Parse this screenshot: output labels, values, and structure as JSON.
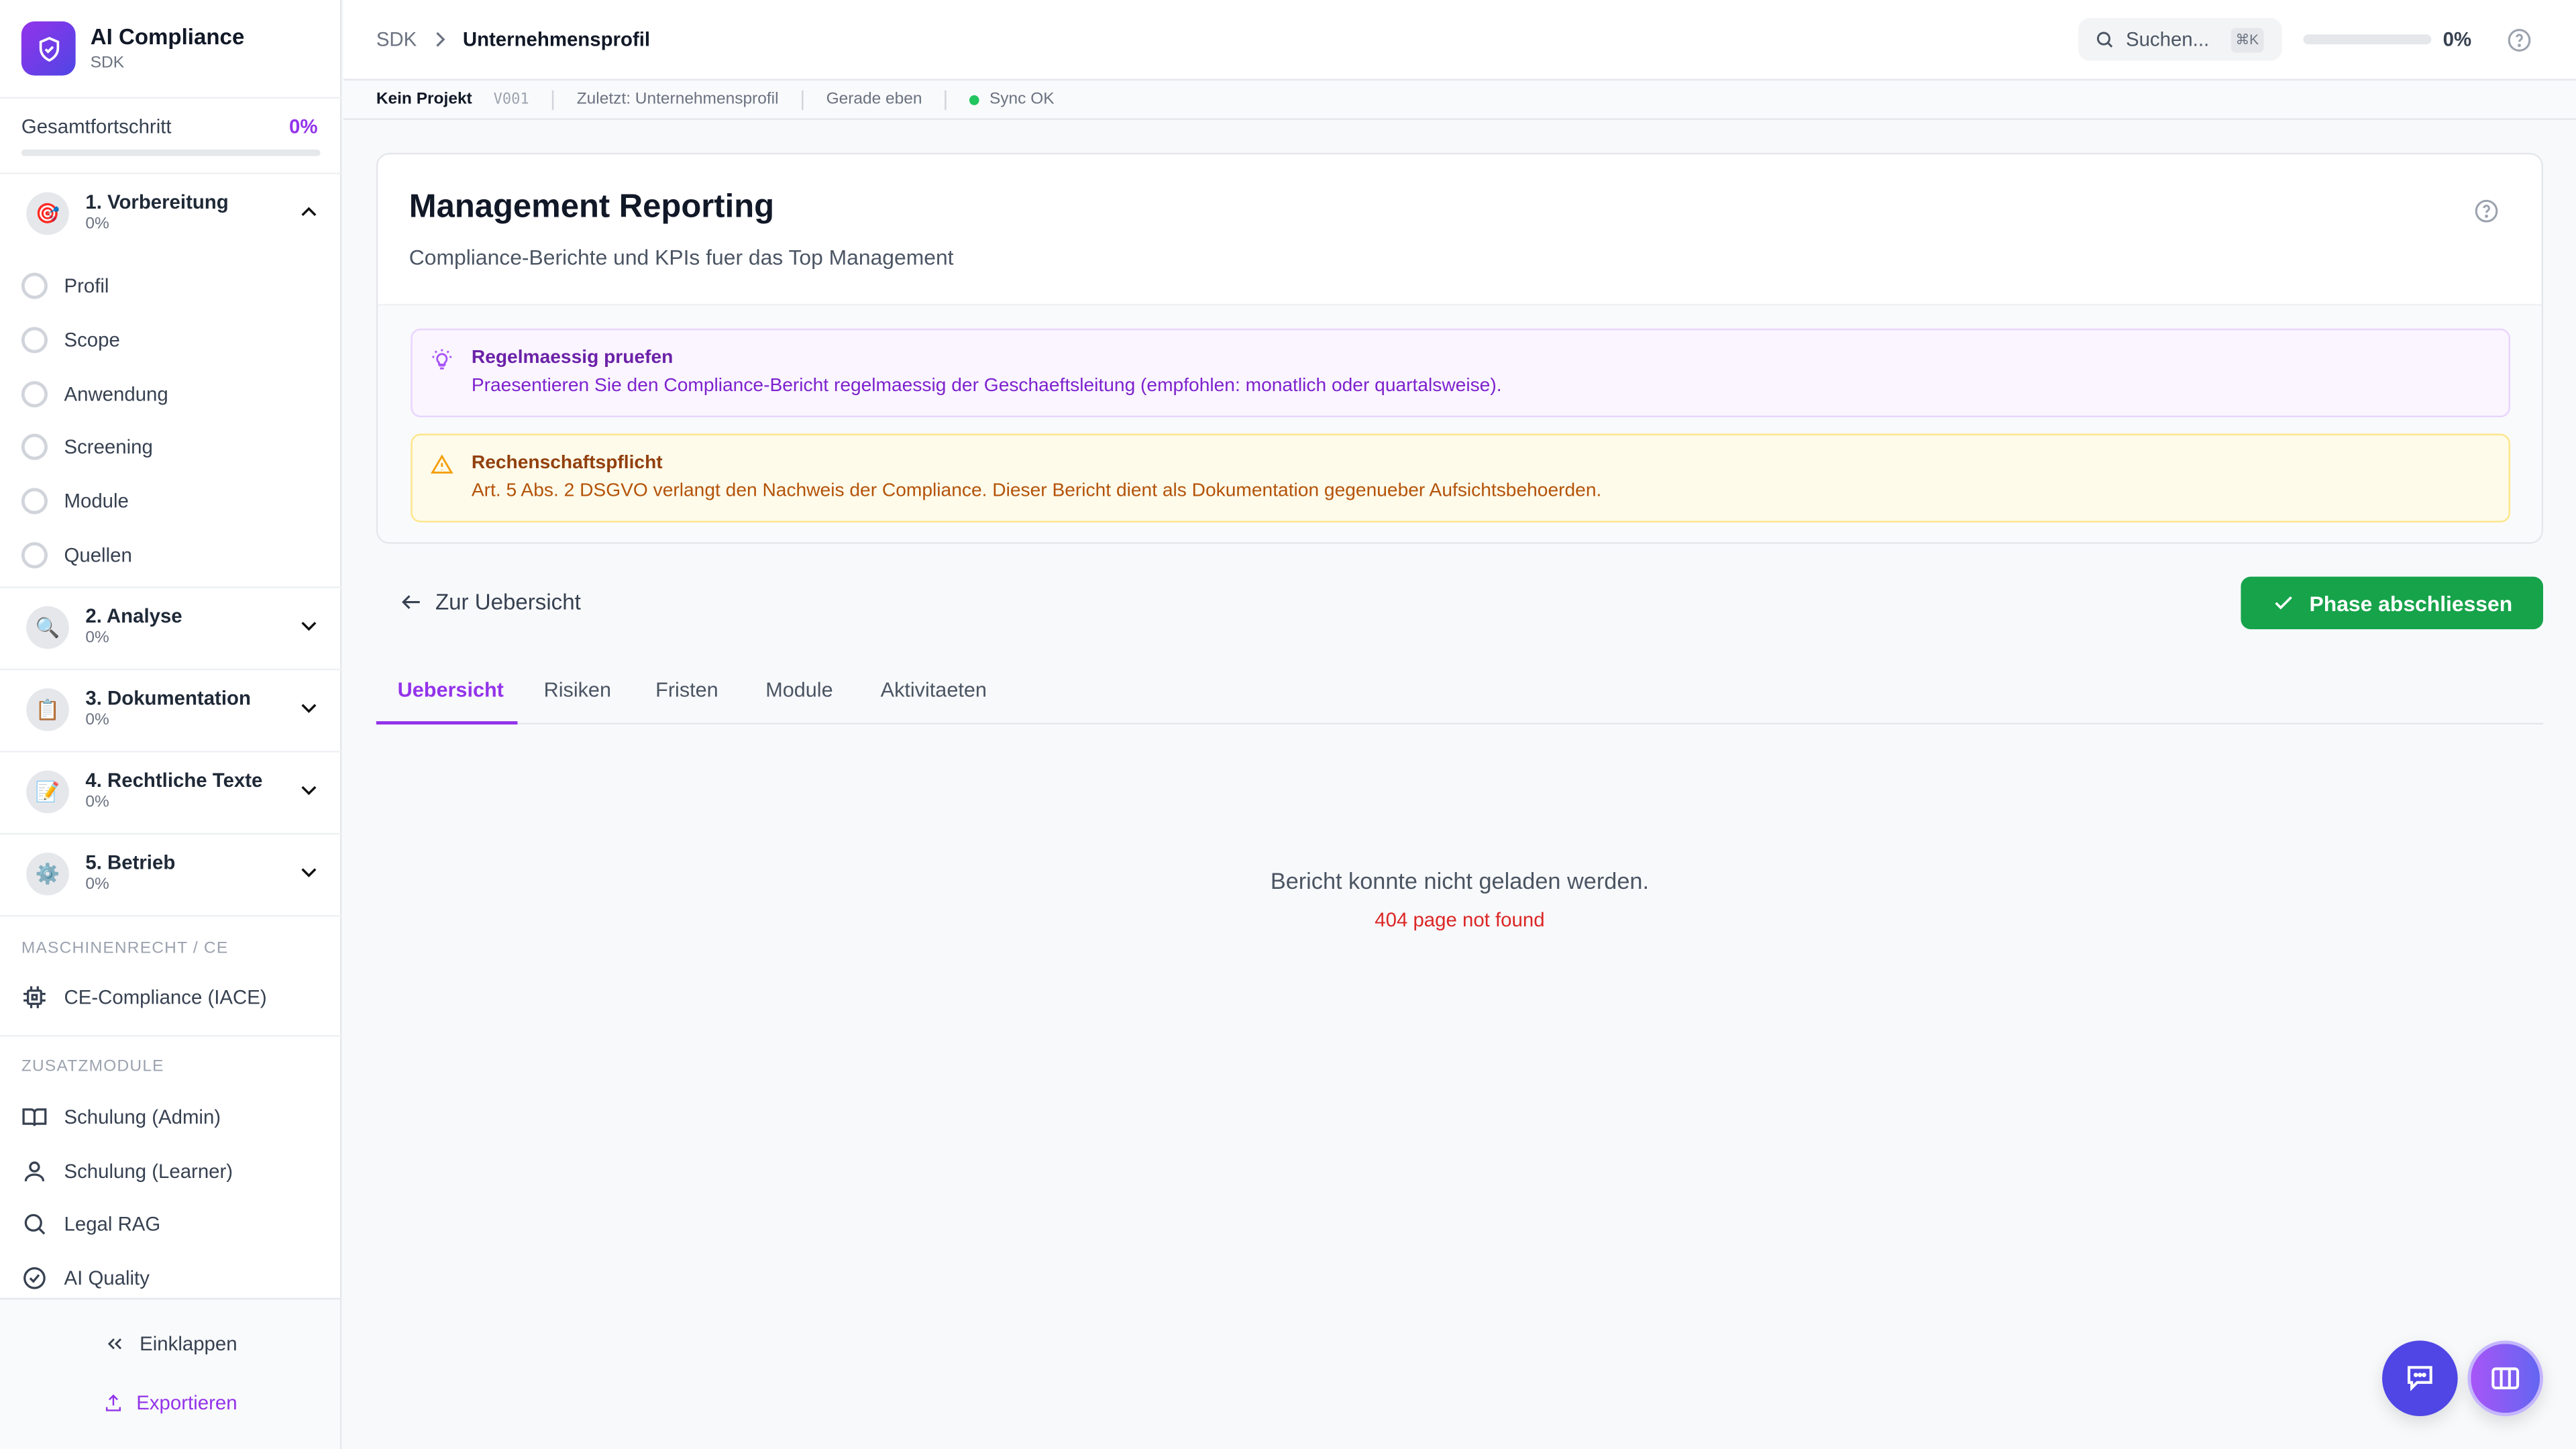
{
  "brand": {
    "title": "AI Compliance",
    "subtitle": "SDK"
  },
  "progress": {
    "label": "Gesamtfortschritt",
    "value": "0%",
    "fraction": 0
  },
  "phases": [
    {
      "title": "1. Vorbereitung",
      "progress": "0%",
      "icon": "target-icon",
      "expanded": true,
      "items": [
        "Profil",
        "Scope",
        "Anwendung",
        "Screening",
        "Module",
        "Quellen"
      ]
    },
    {
      "title": "2. Analyse",
      "progress": "0%",
      "icon": "magnifier-icon"
    },
    {
      "title": "3. Dokumentation",
      "progress": "0%",
      "icon": "clipboard-icon"
    },
    {
      "title": "4. Rechtliche Texte",
      "progress": "0%",
      "icon": "pencil-document-icon"
    },
    {
      "title": "5. Betrieb",
      "progress": "0%",
      "icon": "gear-icon"
    }
  ],
  "sections": {
    "machine": {
      "label": "MASCHINENRECHT / CE",
      "items": [
        "CE-Compliance (IACE)"
      ]
    },
    "extra": {
      "label": "ZUSATZMODULE",
      "items": [
        "Schulung (Admin)",
        "Schulung (Learner)",
        "Legal RAG",
        "AI Quality"
      ]
    }
  },
  "footer": {
    "collapse": "Einklappen",
    "export": "Exportieren"
  },
  "header": {
    "breadcrumb": [
      "SDK",
      "Unternehmensprofil"
    ],
    "search_placeholder": "Suchen...",
    "shortcut": "⌘K",
    "progress": "0%",
    "progress_fraction": 0
  },
  "status": {
    "project": "Kein Projekt",
    "version": "V001",
    "last": "Zuletzt: Unternehmensprofil",
    "time": "Gerade eben",
    "sync": "Sync OK"
  },
  "page": {
    "title": "Management Reporting",
    "subtitle": "Compliance-Berichte und KPIs fuer das Top Management"
  },
  "alerts": [
    {
      "title": "Regelmaessig pruefen",
      "text": "Praesentieren Sie den Compliance-Bericht regelmaessig der Geschaeftsleitung (empfohlen: monatlich oder quartalsweise)."
    },
    {
      "title": "Rechenschaftspflicht",
      "text": "Art. 5 Abs. 2 DSGVO verlangt den Nachweis der Compliance. Dieser Bericht dient als Dokumentation gegenueber Aufsichtsbehoerden."
    }
  ],
  "actions": {
    "back": "Zur Uebersicht",
    "complete": "Phase abschliessen"
  },
  "tabs": [
    {
      "label": "Uebersicht",
      "active": true
    },
    {
      "label": "Risiken"
    },
    {
      "label": "Fristen"
    },
    {
      "label": "Module"
    },
    {
      "label": "Aktivitaeten"
    }
  ],
  "error": {
    "message": "Bericht konnte nicht geladen werden.",
    "detail": "404 page not found"
  },
  "colors": {
    "accent": "#9333ea",
    "success": "#16a34a",
    "error": "#dc2626",
    "fab": "#4f46e5"
  }
}
